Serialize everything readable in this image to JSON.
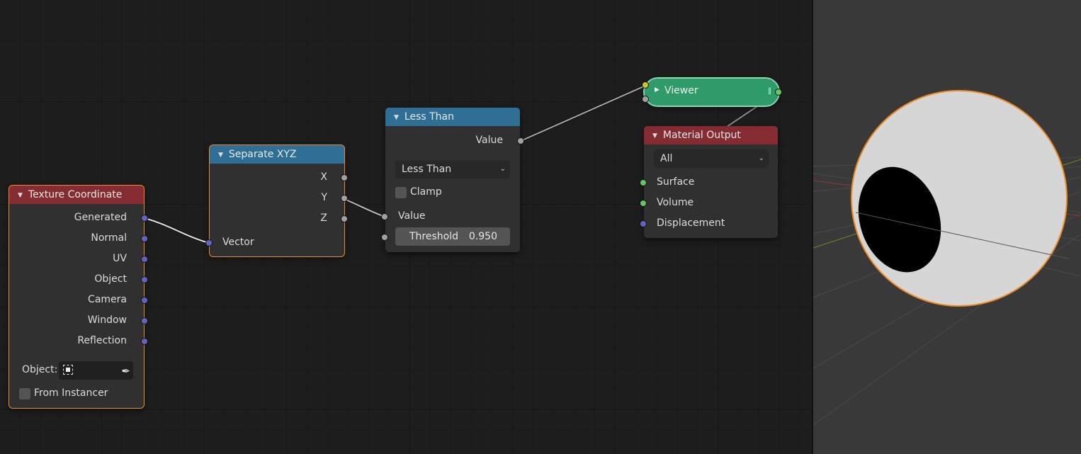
{
  "node_editor": {
    "nodes": {
      "texture_coordinate": {
        "title": "Texture Coordinate",
        "outputs": [
          "Generated",
          "Normal",
          "UV",
          "Object",
          "Camera",
          "Window",
          "Reflection"
        ],
        "object_label": "Object:",
        "from_instancer_label": "From Instancer"
      },
      "separate_xyz": {
        "title": "Separate XYZ",
        "outputs": [
          "X",
          "Y",
          "Z"
        ],
        "input_label": "Vector"
      },
      "math": {
        "title": "Less Than",
        "output_label": "Value",
        "operation": "Less Than",
        "clamp_label": "Clamp",
        "input_value_label": "Value",
        "threshold_label": "Threshold",
        "threshold_value": "0.950"
      },
      "viewer": {
        "title": "Viewer"
      },
      "material_output": {
        "title": "Material Output",
        "target": "All",
        "inputs": [
          "Surface",
          "Volume",
          "Displacement"
        ]
      }
    },
    "colors": {
      "header_input": "#852c33",
      "header_converter": "#2f6f96",
      "header_viewer": "#2f9a6a",
      "selection_outline": "#ed8c24",
      "socket_vector": "#6363c7",
      "socket_float": "#a1a1a1",
      "socket_shader": "#63c763",
      "socket_color": "#c7c729"
    }
  },
  "viewport": {
    "object": "sphere",
    "colors": {
      "sphere_fill": "#d6d6d6",
      "sphere_spot": "#000000",
      "selection_outline": "#ed8c24",
      "background": "#393939"
    }
  }
}
